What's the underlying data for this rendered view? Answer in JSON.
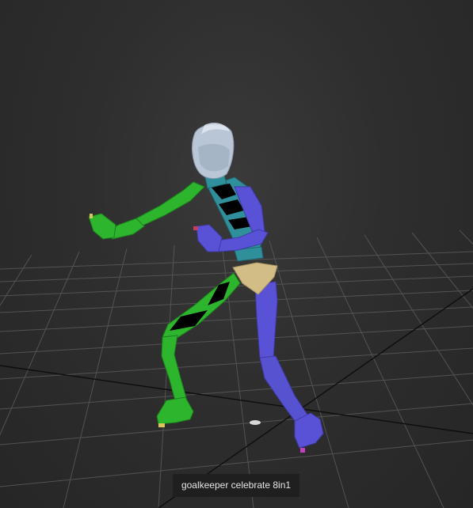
{
  "viewport": {
    "caption": "goalkeeper celebrate 8in1",
    "background_color": "#2e2e2e",
    "grid_color": "#5a5a5a",
    "grid_axis_color": "#0a0a0a"
  },
  "character": {
    "head_color": "#b9c6d6",
    "left_side_color": "#2db52d",
    "right_side_color": "#5a52d6",
    "spine_color": "#2f8f9a",
    "pelvis_color": "#d2bd86",
    "joint_color": "#000000"
  }
}
